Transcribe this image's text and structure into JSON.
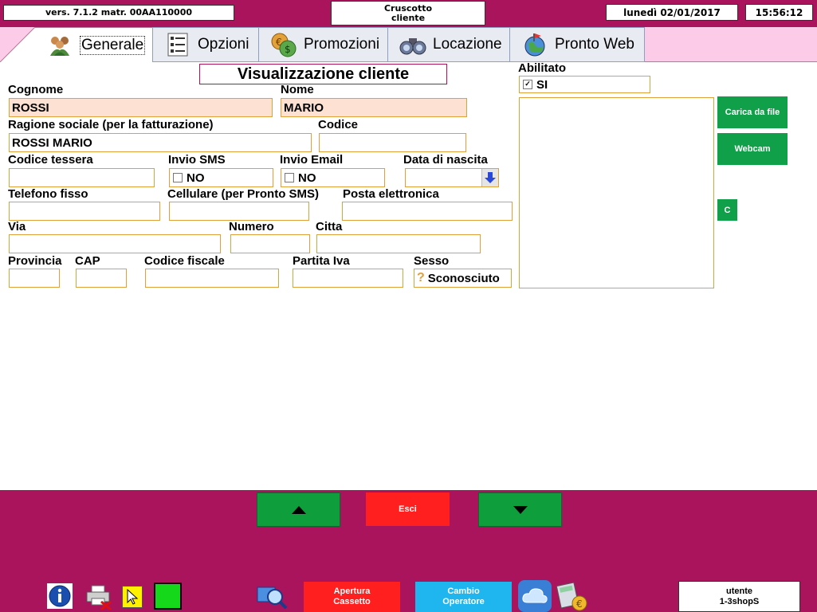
{
  "header": {
    "version": "vers. 7.1.2 matr. 00AA110000",
    "title_line1": "Cruscotto",
    "title_line2": "cliente",
    "date": "lunedì 02/01/2017",
    "time": "15:56:12"
  },
  "tabs": [
    {
      "label": "Generale",
      "icon": "users-icon"
    },
    {
      "label": "Opzioni",
      "icon": "list-icon"
    },
    {
      "label": "Promozioni",
      "icon": "coins-icon"
    },
    {
      "label": "Locazione",
      "icon": "binoculars-icon"
    },
    {
      "label": "Pronto Web",
      "icon": "globe-icon"
    }
  ],
  "form": {
    "title": "Visualizzazione cliente",
    "cognome": {
      "label": "Cognome",
      "value": "ROSSI"
    },
    "nome": {
      "label": "Nome",
      "value": "MARIO"
    },
    "ragione_sociale": {
      "label": "Ragione sociale (per la fatturazione)",
      "value": "ROSSI MARIO"
    },
    "codice": {
      "label": "Codice",
      "value": ""
    },
    "codice_tessera": {
      "label": "Codice tessera",
      "value": ""
    },
    "invio_sms": {
      "label": "Invio SMS",
      "value": "NO"
    },
    "invio_email": {
      "label": "Invio Email",
      "value": "NO"
    },
    "data_nascita": {
      "label": "Data di nascita",
      "value": ""
    },
    "telefono": {
      "label": "Telefono fisso",
      "value": ""
    },
    "cellulare": {
      "label": "Cellulare (per Pronto SMS)",
      "value": ""
    },
    "email": {
      "label": "Posta elettronica",
      "value": ""
    },
    "via": {
      "label": "Via",
      "value": ""
    },
    "numero": {
      "label": "Numero",
      "value": ""
    },
    "citta": {
      "label": "Citta",
      "value": ""
    },
    "provincia": {
      "label": "Provincia",
      "value": ""
    },
    "cap": {
      "label": "CAP",
      "value": ""
    },
    "codice_fiscale": {
      "label": "Codice fiscale",
      "value": ""
    },
    "partita_iva": {
      "label": "Partita Iva",
      "value": ""
    },
    "sesso": {
      "label": "Sesso",
      "value": "Sconosciuto"
    },
    "abilitato": {
      "label": "Abilitato",
      "value": "SI"
    }
  },
  "photo": {
    "load_label": "Carica da file",
    "webcam_label": "Webcam",
    "clear_label": "C"
  },
  "bottom": {
    "exit_label": "Esci",
    "cash_drawer_line1": "Apertura",
    "cash_drawer_line2": "Cassetto",
    "change_op_line1": "Cambio",
    "change_op_line2": "Operatore",
    "user_line1": "utente",
    "user_line2": "1-3shopS"
  },
  "colors": {
    "frame": "#a9145d",
    "tab_strip": "#fccbe7",
    "field_border": "#e0a13a",
    "field_highlight": "#fde1d2",
    "green_button": "#10a04a",
    "exit_button": "#ff1f1f",
    "operator_button": "#1fb6f0"
  }
}
